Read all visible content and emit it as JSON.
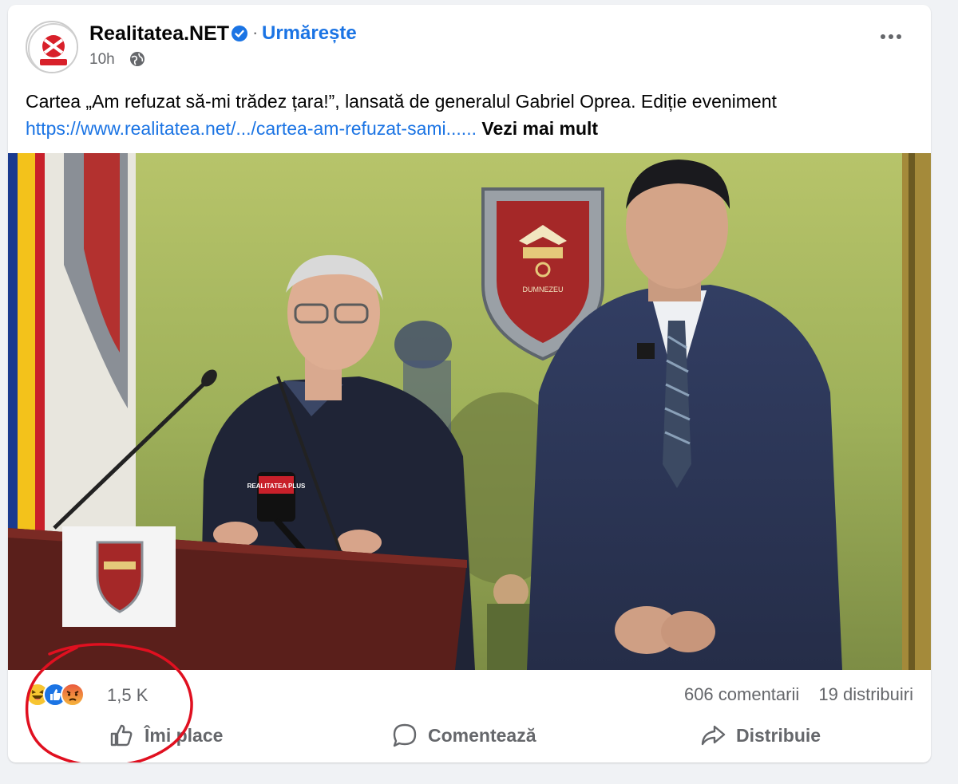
{
  "post": {
    "page_name": "Realitatea.NET",
    "follow_label": "Urmărește",
    "separator": "·",
    "time": "10h",
    "text": "Cartea „Am refuzat să-mi trădez țara!”, lansată de generalul Gabriel Oprea. Ediție eveniment",
    "link": "https://www.realitatea.net/.../cartea-am-refuzat-sami......",
    "see_more": "Vezi mai mult"
  },
  "icons": {
    "verified": "verified-badge-icon",
    "privacy": "globe-icon",
    "menu": "more-options-icon",
    "reactions": [
      "haha-reaction-icon",
      "like-reaction-icon",
      "angry-reaction-icon"
    ]
  },
  "media": {
    "badge_text": "DUMNEZEU",
    "mic_label": "REALITATEA PLUS"
  },
  "stats": {
    "reactions_count": "1,5 K",
    "comments": "606 comentarii",
    "shares": "19 distribuiri"
  },
  "actions": {
    "like": "Îmi place",
    "comment": "Comentează",
    "share": "Distribuie"
  },
  "colors": {
    "accent": "#1b74e4",
    "muted": "#65676b",
    "annotation": "#e01020"
  }
}
